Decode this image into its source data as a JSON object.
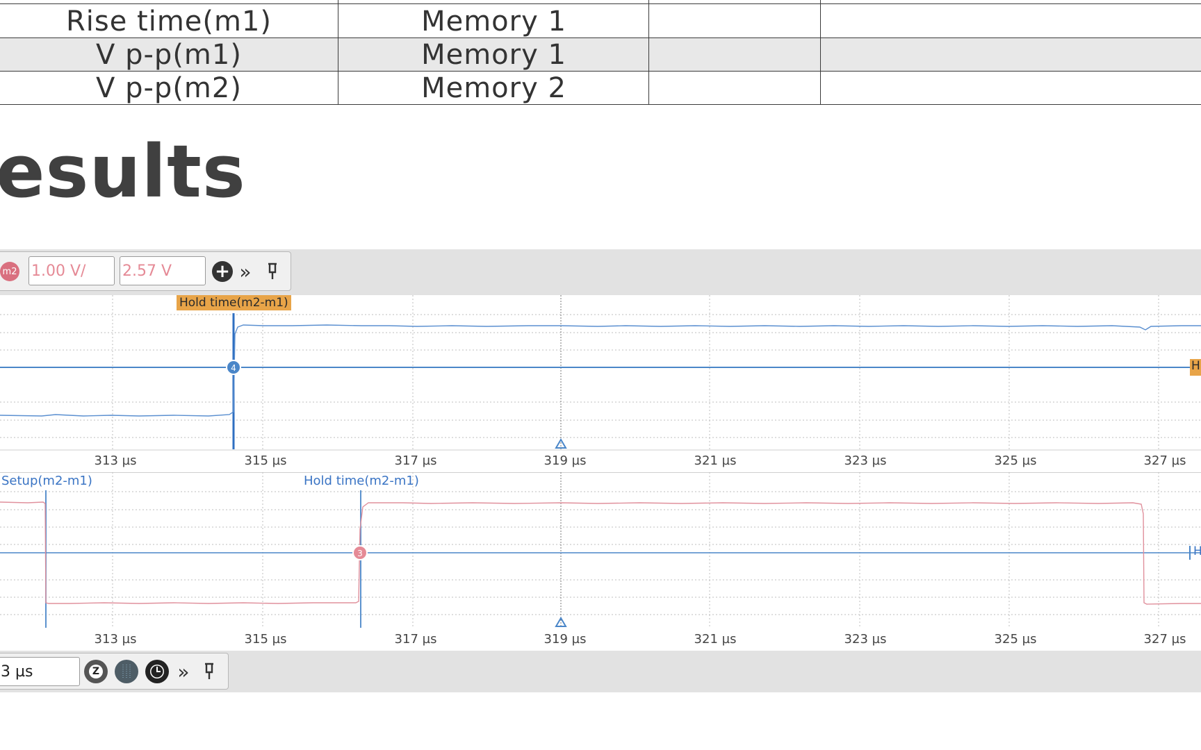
{
  "measurements_table": {
    "columns": [
      "",
      "",
      "",
      ""
    ],
    "rows": [
      {
        "name": "Rise time(m1)",
        "source": "Memory 1",
        "shaded": false
      },
      {
        "name": "V p-p(m1)",
        "source": "Memory 1",
        "shaded": true
      },
      {
        "name": "V p-p(m2)",
        "source": "Memory 2",
        "shaded": false
      }
    ]
  },
  "section": {
    "heading": "esults"
  },
  "channel_toolbar": {
    "channel_badge": "m2",
    "scale_value": "1.00 V/",
    "offset_value": "2.57 V",
    "add_icon": "plus-circle-icon",
    "expand_icon": "double-chevron-right-icon",
    "pin_icon": "pin-icon",
    "accent_color": "#e58a96"
  },
  "upper_trace": {
    "marker_label": "Hold time(m2-m1)",
    "cursor_index": "4",
    "edge_label": "H",
    "trace_color": "#4a86c8"
  },
  "lower_trace": {
    "marker_label_1": "Setup(m2-m1)",
    "marker_label_2": "Hold time(m2-m1)",
    "cursor_index": "3",
    "edge_label": "H",
    "trace_color": "#e58a96"
  },
  "time_axis": {
    "tick_labels": [
      "313 µs",
      "315 µs",
      "317 µs",
      "319 µs",
      "321 µs",
      "323 µs",
      "325 µs",
      "327 µs"
    ]
  },
  "time_toolbar": {
    "timebase_value": "3 µs",
    "zoom_icon": "zoom-z-icon",
    "persistence_icon": "display-grid-icon",
    "clock_icon": "clock-icon",
    "expand_icon": "double-chevron-right-icon",
    "pin_icon": "pin-icon"
  }
}
